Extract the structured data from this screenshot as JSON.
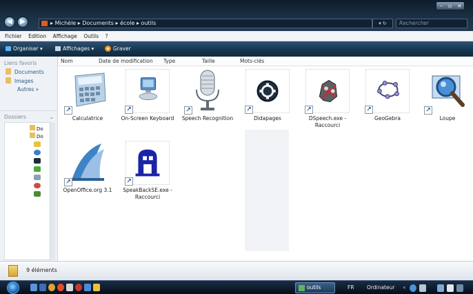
{
  "window": {
    "breadcrumb": [
      "Michèle",
      "Documents",
      "école",
      "outils"
    ],
    "search_placeholder": "Rechercher"
  },
  "menubar": [
    "Fichier",
    "Edition",
    "Affichage",
    "Outils",
    "?"
  ],
  "toolbar": {
    "organiser": "Organiser",
    "affichages": "Affichages",
    "graver": "Graver"
  },
  "sidebar": {
    "favorites_title": "Liens favoris",
    "favorites": [
      "Documents",
      "Images",
      "Autres »"
    ],
    "folders_title": "Dossiers",
    "tree_items": [
      "Do",
      "Do"
    ]
  },
  "columns": [
    "Nom",
    "Date de modification",
    "Type",
    "Taille",
    "Mots-clés"
  ],
  "items": [
    {
      "label": "Calculatrice",
      "icon": "calculator-icon"
    },
    {
      "label": "On-Screen Keyboard",
      "icon": "keyboard-icon"
    },
    {
      "label": "Speech Recognition",
      "icon": "microphone-icon"
    },
    {
      "label": "Didapages",
      "icon": "didapages-icon"
    },
    {
      "label": "DSpeech.exe - Raccourci",
      "icon": "dspeech-icon"
    },
    {
      "label": "GeoGebra",
      "icon": "geogebra-icon"
    },
    {
      "label": "Loupe",
      "icon": "magnifier-icon"
    },
    {
      "label": "OpenOffice.org 3.1",
      "icon": "openoffice-icon"
    },
    {
      "label": "SpeakBackSE.exe - Raccourci",
      "icon": "speakback-icon"
    }
  ],
  "status": {
    "count_text": "9 éléments"
  },
  "taskbar": {
    "active_window": "outils",
    "language": "FR",
    "toolbar_label": "Ordinateur"
  },
  "colors": {
    "titlebar": "#1c3246",
    "toolbar": "#173650",
    "accent": "#1a56a8"
  }
}
